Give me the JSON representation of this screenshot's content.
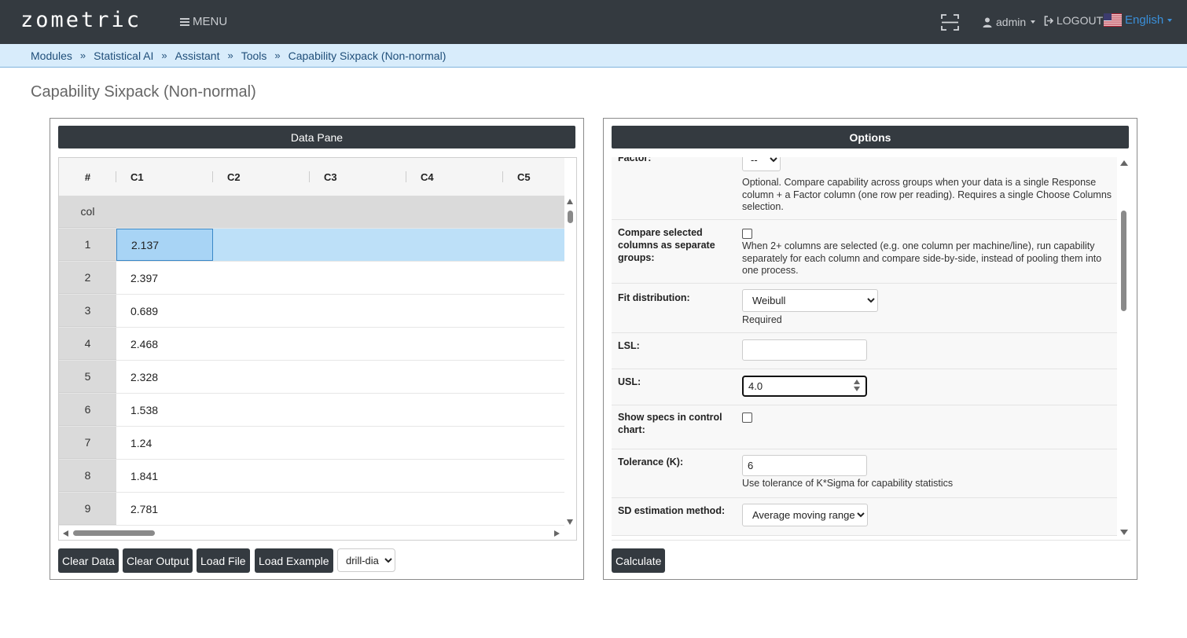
{
  "app": {
    "logo": "zometric",
    "menu_label": "MENU",
    "user": "admin",
    "logout_label": "LOGOUT",
    "language": "English"
  },
  "breadcrumb": [
    "Modules",
    "Statistical AI",
    "Assistant",
    "Tools",
    "Capability Sixpack (Non-normal)"
  ],
  "breadcrumb_sep": "»",
  "page_title": "Capability Sixpack (Non-normal)",
  "data_pane": {
    "title": "Data Pane",
    "columns": [
      "#",
      "C1",
      "C2",
      "C3",
      "C4",
      "C5"
    ],
    "name_row_label": "col",
    "rows": [
      {
        "n": "1",
        "c1": "2.137"
      },
      {
        "n": "2",
        "c1": "2.397"
      },
      {
        "n": "3",
        "c1": "0.689"
      },
      {
        "n": "4",
        "c1": "2.468"
      },
      {
        "n": "5",
        "c1": "2.328"
      },
      {
        "n": "6",
        "c1": "1.538"
      },
      {
        "n": "7",
        "c1": "1.24"
      },
      {
        "n": "8",
        "c1": "1.841"
      },
      {
        "n": "9",
        "c1": "2.781"
      }
    ],
    "buttons": {
      "clear_data": "Clear Data",
      "clear_output": "Clear Output",
      "load_file": "Load File",
      "load_example": "Load Example"
    },
    "example_select": "drill-dia"
  },
  "options": {
    "title": "Options",
    "factor": {
      "label": "Factor:",
      "value": "--",
      "help": "Optional. Compare capability across groups when your data is a single Response column + a Factor column (one row per reading). Requires a single Choose Columns selection."
    },
    "compare": {
      "label": "Compare selected columns as separate groups:",
      "checked": false,
      "help": "When 2+ columns are selected (e.g. one column per machine/line), run capability separately for each column and compare side-by-side, instead of pooling them into one process."
    },
    "fit": {
      "label": "Fit distribution:",
      "value": "Weibull",
      "help": "Required"
    },
    "lsl": {
      "label": "LSL:",
      "value": ""
    },
    "usl": {
      "label": "USL:",
      "value": "4.0"
    },
    "show_specs": {
      "label": "Show specs in control chart:",
      "checked": false
    },
    "tolerance": {
      "label": "Tolerance (K):",
      "value": "6",
      "help": "Use tolerance of K*Sigma for capability statistics"
    },
    "sd_method": {
      "label": "SD estimation method:",
      "value": "Average moving range"
    },
    "calculate_label": "Calculate"
  },
  "colors": {
    "navbar": "#343a40",
    "breadcrumb_bg": "#d8ecfb",
    "selection": "#bde0f8",
    "language_link": "#3a8fd9"
  }
}
